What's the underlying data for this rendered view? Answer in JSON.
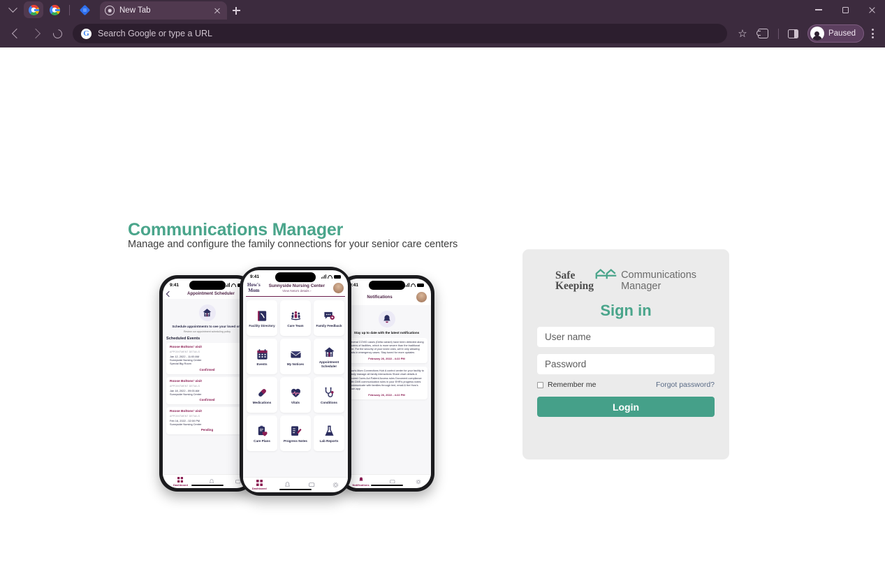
{
  "browser": {
    "tab": {
      "title": "New Tab",
      "favicon": "chrome-icon"
    },
    "toolbar": {
      "omnibox_placeholder": "Search Google or type a URL",
      "profile_label": "Paused"
    }
  },
  "hero": {
    "title": "Communications Manager",
    "subtitle": "Manage and configure the family connections for your senior care centers"
  },
  "signin": {
    "logo_line1": "Safe",
    "logo_line2": "Keeping",
    "logo_right_line1": "Communications",
    "logo_right_line2": "Manager",
    "heading": "Sign in",
    "username_placeholder": "User name",
    "password_placeholder": "Password",
    "remember_label": "Remember me",
    "forgot_label": "Forgot password?",
    "login_label": "Login",
    "accent_color": "#45a089",
    "panel_color": "#ebebeb"
  },
  "phones": {
    "left": {
      "time": "9:41",
      "title": "Appointment Scheduler",
      "caption": "Schedule appointments to see your loved one",
      "policy": "Review our appointment scheduling policy",
      "section": "Scheduled Events",
      "events": [
        {
          "name": "Roose Boltons' visit",
          "sub": "APPOINTMENT DETAILS",
          "datetime": "Jan 12, 2022 - 11:00 AM",
          "facility": "Sunnyside Nursing Center",
          "room": "Special Big Room",
          "status": "Confirmed"
        },
        {
          "name": "Roose Boltons' visit",
          "sub": "APPOINTMENT DETAILS",
          "datetime": "Jan 18, 2022 - 09:00 AM",
          "facility": "Sunnyside Nursing Center",
          "room": "",
          "status": "Confirmed"
        },
        {
          "name": "Roose Boltons' visit",
          "sub": "APPOINTMENT DETAILS",
          "datetime": "Feb 16, 2022 - 02:00 PM",
          "facility": "Sunnyside Nursing Center",
          "room": "",
          "status": "Pending"
        }
      ],
      "nav_label": "Dashboard"
    },
    "center": {
      "time": "9:41",
      "logo_line1": "How's",
      "logo_line2": "Mom",
      "facility": "Sunnyside Nursing Center",
      "facility_sub": "View Neta's details ›",
      "tiles": [
        {
          "label": "Facility Directory",
          "icon": "book-icon"
        },
        {
          "label": "Care Team",
          "icon": "care-team-icon"
        },
        {
          "label": "Family Feedback",
          "icon": "chat-icon"
        },
        {
          "label": "Events",
          "icon": "calendar-icon"
        },
        {
          "label": "My Notices",
          "icon": "envelope-icon"
        },
        {
          "label": "Appointment Scheduler",
          "icon": "house-icon"
        },
        {
          "label": "Medications",
          "icon": "pill-icon"
        },
        {
          "label": "Vitals",
          "icon": "heart-icon"
        },
        {
          "label": "Conditions",
          "icon": "stethoscope-icon"
        },
        {
          "label": "Care Plans",
          "icon": "clipboard-heart-icon"
        },
        {
          "label": "Progress Notes",
          "icon": "notes-icon"
        },
        {
          "label": "Lab Reports",
          "icon": "flask-icon"
        }
      ],
      "nav_label": "Dashboard"
    },
    "right": {
      "time": "9:41",
      "title": "Notifications",
      "caption": "Stay up to date with the latest notifications",
      "notifications": [
        {
          "text": "Several COVID cases (Delta variant) have been detected along dozens of facilities, which is more severe than the traditional one. For the security of your loved ones, we're only allowing visits in emergency cases. Stay tuned for more updates",
          "date": "February 26, 2022 - 4:22 PM"
        },
        {
          "text": "How's Mom Connections Hub A control center for your facility to easily manage all family interactions Share chart details & exceed Cures Act Patient Access rules Document compliance with CMS communication rules in your EHR's progress notes Communicate with families through text, email & the How's Mom app",
          "date": "February 26, 2022 - 4:22 PM"
        }
      ],
      "nav_label": "Notifications"
    }
  }
}
